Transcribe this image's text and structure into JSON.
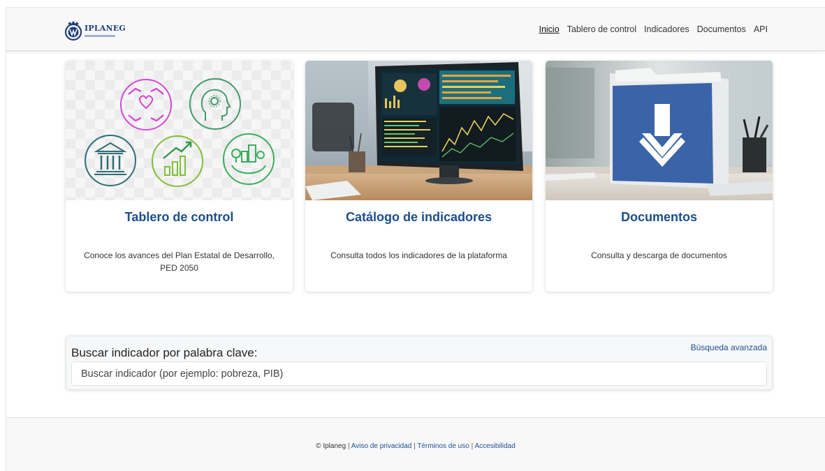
{
  "brand": {
    "name": "IPLANEG"
  },
  "nav": {
    "items": [
      {
        "label": "Inicio",
        "active": true
      },
      {
        "label": "Tablero de control"
      },
      {
        "label": "Indicadores"
      },
      {
        "label": "Documentos"
      },
      {
        "label": "API"
      }
    ]
  },
  "cards": [
    {
      "title": "Tablero de control",
      "description": "Conoce los avances del Plan Estatal de Desarrollo, PED 2050"
    },
    {
      "title": "Catálogo de indicadores",
      "description": "Consulta todos los indicadores de la plataforma"
    },
    {
      "title": "Documentos",
      "description": "Consulta y descarga de documentos"
    }
  ],
  "search": {
    "label": "Buscar indicador por palabra clave:",
    "advanced_link": "Búsqueda avanzada",
    "placeholder": "Buscar indicador (por ejemplo: pobreza, PIB)"
  },
  "footer": {
    "copyright": "© Iplaneg",
    "links": [
      "Aviso de privacidad",
      "Términos de uso",
      "Accesibilidad"
    ],
    "separator": "|"
  },
  "colors": {
    "title_blue": "#1c4e8a",
    "link_blue": "#1f4f8f",
    "icon_magenta": "#d44ad6",
    "icon_green": "#3f9a6b",
    "icon_teal": "#2f6d78",
    "icon_lime": "#7fbf3a",
    "folder_blue": "#3b64a8"
  },
  "icons": {
    "card1": [
      "hands-heart-icon",
      "head-gear-icon",
      "government-building-icon",
      "growth-chart-icon",
      "green-city-globe-icon"
    ],
    "card2": "computer-monitor-dashboard-image",
    "card3": "folder-download-icon"
  }
}
